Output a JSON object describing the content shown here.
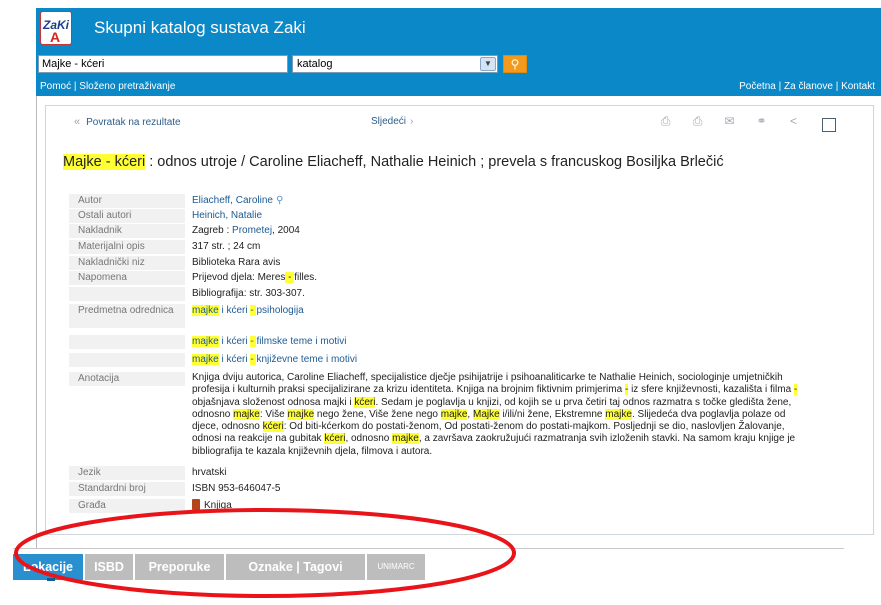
{
  "header": {
    "logo_text": "ZaKi",
    "title": "Skupni katalog sustava Zaki"
  },
  "search": {
    "query": "Majke - kćeri",
    "scope": "katalog",
    "button_icon": "search-icon"
  },
  "links": {
    "help": "Pomoć",
    "advanced": "Složeno pretraživanje",
    "home": "Početna",
    "members": "Za članove",
    "contact": "Kontakt",
    "separator": " | "
  },
  "nav": {
    "back": "Povratak na rezultate",
    "next": "Sljedeći"
  },
  "record": {
    "title_highlight": "Majke - kćeri",
    "title_rest": " : odnos utroje / Caroline Eliacheff, Nathalie Heinich ; prevela s francuskog Bosiljka Brlečić",
    "fields": {
      "author": {
        "label": "Autor",
        "value": "Eliacheff, Caroline"
      },
      "other_authors": {
        "label": "Ostali autori",
        "value": "Heinich, Natalie"
      },
      "publisher": {
        "label": "Nakladnik",
        "place": "Zagreb : ",
        "name": "Prometej",
        "year": ", 2004"
      },
      "physical": {
        "label": "Materijalni opis",
        "value": "317 str. ; 24 cm"
      },
      "series": {
        "label": "Nakladnički niz",
        "value": "Biblioteka Rara avis"
      },
      "note": {
        "label": "Napomena",
        "value_a": "Prijevod djela: Meres",
        "value_hl": " - ",
        "value_b": "filles.",
        "value2": "Bibliografija: str. 303-307."
      },
      "subjects": {
        "label": "Predmetna odrednica",
        "items": [
          {
            "a": "majke",
            "b": " i kćeri ",
            "c": " - ",
            "d": " psihologija"
          },
          {
            "a": "majke",
            "b": " i kćeri ",
            "c": " - ",
            "d": " filmske teme i motivi"
          },
          {
            "a": "majke",
            "b": " i kćeri ",
            "c": " - ",
            "d": " književne teme i motivi"
          }
        ]
      },
      "annotation": {
        "label": "Anotacija",
        "parts": [
          {
            "t": "Knjiga dviju autorica, Caroline Eliacheff, specijalistice dječje psihijatrije i psihoanaliticarke te Nathalie Heinich, sociologinje umjetničkih profesija i kulturnih praksi specijalizirane za krizu identiteta. Knjiga na brojnim fiktivnim primjerima ",
            "h": false
          },
          {
            "t": "-",
            "h": true
          },
          {
            "t": " iz sfere književnosti, kazališta i filma ",
            "h": false
          },
          {
            "t": "-",
            "h": true
          },
          {
            "t": " objašnjava složenost odnosa majki i ",
            "h": false
          },
          {
            "t": "kćeri",
            "h": true
          },
          {
            "t": ". Sedam je poglavlja u knjizi, od kojih se u prva četiri taj odnos razmatra s točke gledišta žene, odnosno ",
            "h": false
          },
          {
            "t": "majke",
            "h": true
          },
          {
            "t": ": Više ",
            "h": false
          },
          {
            "t": "majke",
            "h": true
          },
          {
            "t": " nego žene, Više žene nego ",
            "h": false
          },
          {
            "t": "majke",
            "h": true
          },
          {
            "t": ", ",
            "h": false
          },
          {
            "t": "Majke",
            "h": true
          },
          {
            "t": " i/ili/ni žene, Ekstremne ",
            "h": false
          },
          {
            "t": "majke",
            "h": true
          },
          {
            "t": ". Slijedeća dva poglavlja polaze od djece, odnosno ",
            "h": false
          },
          {
            "t": "kćeri",
            "h": true
          },
          {
            "t": ": Od biti-kćerkom do postati-ženom, Od postati-ženom do postati-majkom. Posljednji se dio, naslovljen Žalovanje, odnosi na reakcije na gubitak ",
            "h": false
          },
          {
            "t": "kćeri",
            "h": true
          },
          {
            "t": ", odnosno ",
            "h": false
          },
          {
            "t": "majke",
            "h": true
          },
          {
            "t": ", a završava zaokružujući razmatranja svih izloženih stavki. Na samom kraju knjige je bibliografija te kazala književnih djela, filmova i autora.",
            "h": false
          }
        ]
      },
      "language": {
        "label": "Jezik",
        "value": "hrvatski"
      },
      "isbn": {
        "label": "Standardni broj",
        "value": "ISBN 953-646047-5"
      },
      "material": {
        "label": "Građa",
        "value": "Knjiga"
      }
    }
  },
  "tabs": [
    {
      "label": "Lokacije",
      "active": true
    },
    {
      "label": "ISBD",
      "active": false
    },
    {
      "label": "Preporuke",
      "active": false
    },
    {
      "label": "Oznake | Tagovi",
      "active": false
    },
    {
      "label": "UNIMARC",
      "active": false
    }
  ],
  "colors": {
    "header": "#0a88c7",
    "accent": "#f39a1c",
    "highlight": "#ffff33",
    "active_tab": "#2a8fcf",
    "ring": "#e8141a"
  }
}
